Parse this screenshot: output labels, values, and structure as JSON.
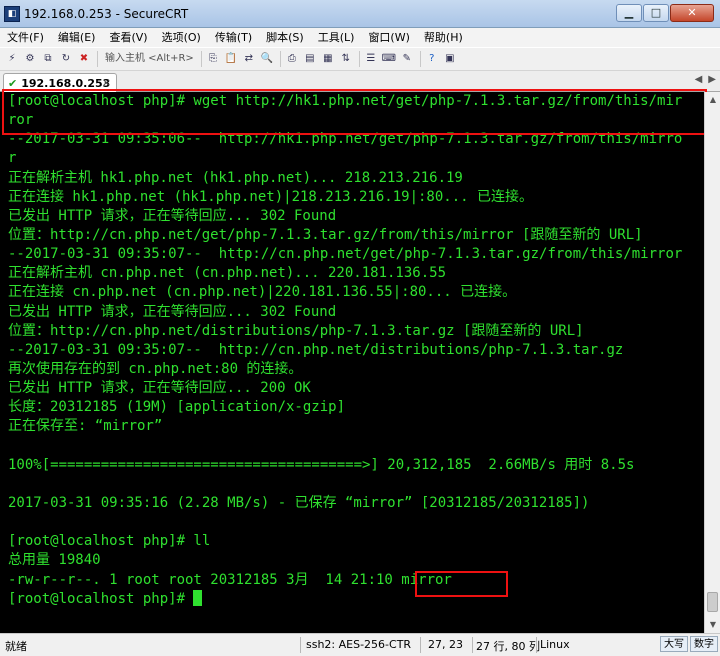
{
  "window": {
    "title": "192.168.0.253 - SecureCRT",
    "app_icon": "securecrt-icon",
    "controls": {
      "minimize": "▁",
      "maximize": "□",
      "close": "✕"
    }
  },
  "menu": {
    "items": [
      "文件(F)",
      "编辑(E)",
      "查看(V)",
      "选项(O)",
      "传输(T)",
      "脚本(S)",
      "工具(L)",
      "窗口(W)",
      "帮助(H)"
    ]
  },
  "toolbar": {
    "quick_connect_placeholder": "输入主机 <Alt+R>",
    "icons_left": [
      "connect-icon",
      "quick-connect-icon",
      "connect-tab-icon",
      "reconnect-icon",
      "disconnect-icon"
    ],
    "icons_right": [
      "copy-icon",
      "paste-icon",
      "copy-paste-icon",
      "find-icon",
      "print-icon",
      "print-setup-icon",
      "log-icon",
      "sftp-icon",
      "session-options-icon",
      "keymap-icon",
      "script-icon",
      "help-icon",
      "about-icon"
    ]
  },
  "tabs": [
    {
      "label": "192.168.0.253",
      "status": "connected"
    }
  ],
  "terminal": {
    "lines": [
      "[root@localhost php]# wget http://hk1.php.net/get/php-7.1.3.tar.gz/from/this/mir",
      "ror",
      "--2017-03-31 09:35:06--  http://hk1.php.net/get/php-7.1.3.tar.gz/from/this/mirro",
      "r",
      "正在解析主机 hk1.php.net (hk1.php.net)... 218.213.216.19",
      "正在连接 hk1.php.net (hk1.php.net)|218.213.216.19|:80... 已连接。",
      "已发出 HTTP 请求，正在等待回应... 302 Found",
      "位置：http://cn.php.net/get/php-7.1.3.tar.gz/from/this/mirror [跟随至新的 URL]",
      "--2017-03-31 09:35:07--  http://cn.php.net/get/php-7.1.3.tar.gz/from/this/mirror",
      "正在解析主机 cn.php.net (cn.php.net)... 220.181.136.55",
      "正在连接 cn.php.net (cn.php.net)|220.181.136.55|:80... 已连接。",
      "已发出 HTTP 请求，正在等待回应... 302 Found",
      "位置：http://cn.php.net/distributions/php-7.1.3.tar.gz [跟随至新的 URL]",
      "--2017-03-31 09:35:07--  http://cn.php.net/distributions/php-7.1.3.tar.gz",
      "再次使用存在的到 cn.php.net:80 的连接。",
      "已发出 HTTP 请求，正在等待回应... 200 OK",
      "长度：20312185 (19M) [application/x-gzip]",
      "正在保存至: “mirror”",
      "",
      "100%[=====================================>] 20,312,185  2.66MB/s 用时 8.5s",
      "",
      "2017-03-31 09:35:16 (2.28 MB/s) - 已保存 “mirror” [20312185/20312185])",
      "",
      "[root@localhost php]# ll",
      "总用量 19840",
      "-rw-r--r--. 1 root root 20312185 3月  14 21:10 mirror",
      "[root@localhost php]# "
    ],
    "foreground": "#2fe02f",
    "background": "#000000",
    "highlight_color": "#e11111"
  },
  "statusbar": {
    "ready": "就绪",
    "cipher": "ssh2: AES-256-CTR",
    "cursor_pos": "27,  23",
    "rows_cols": "27 行, 80 列",
    "os": "Linux",
    "ime_mode": "大写",
    "ime_num": "数字"
  }
}
